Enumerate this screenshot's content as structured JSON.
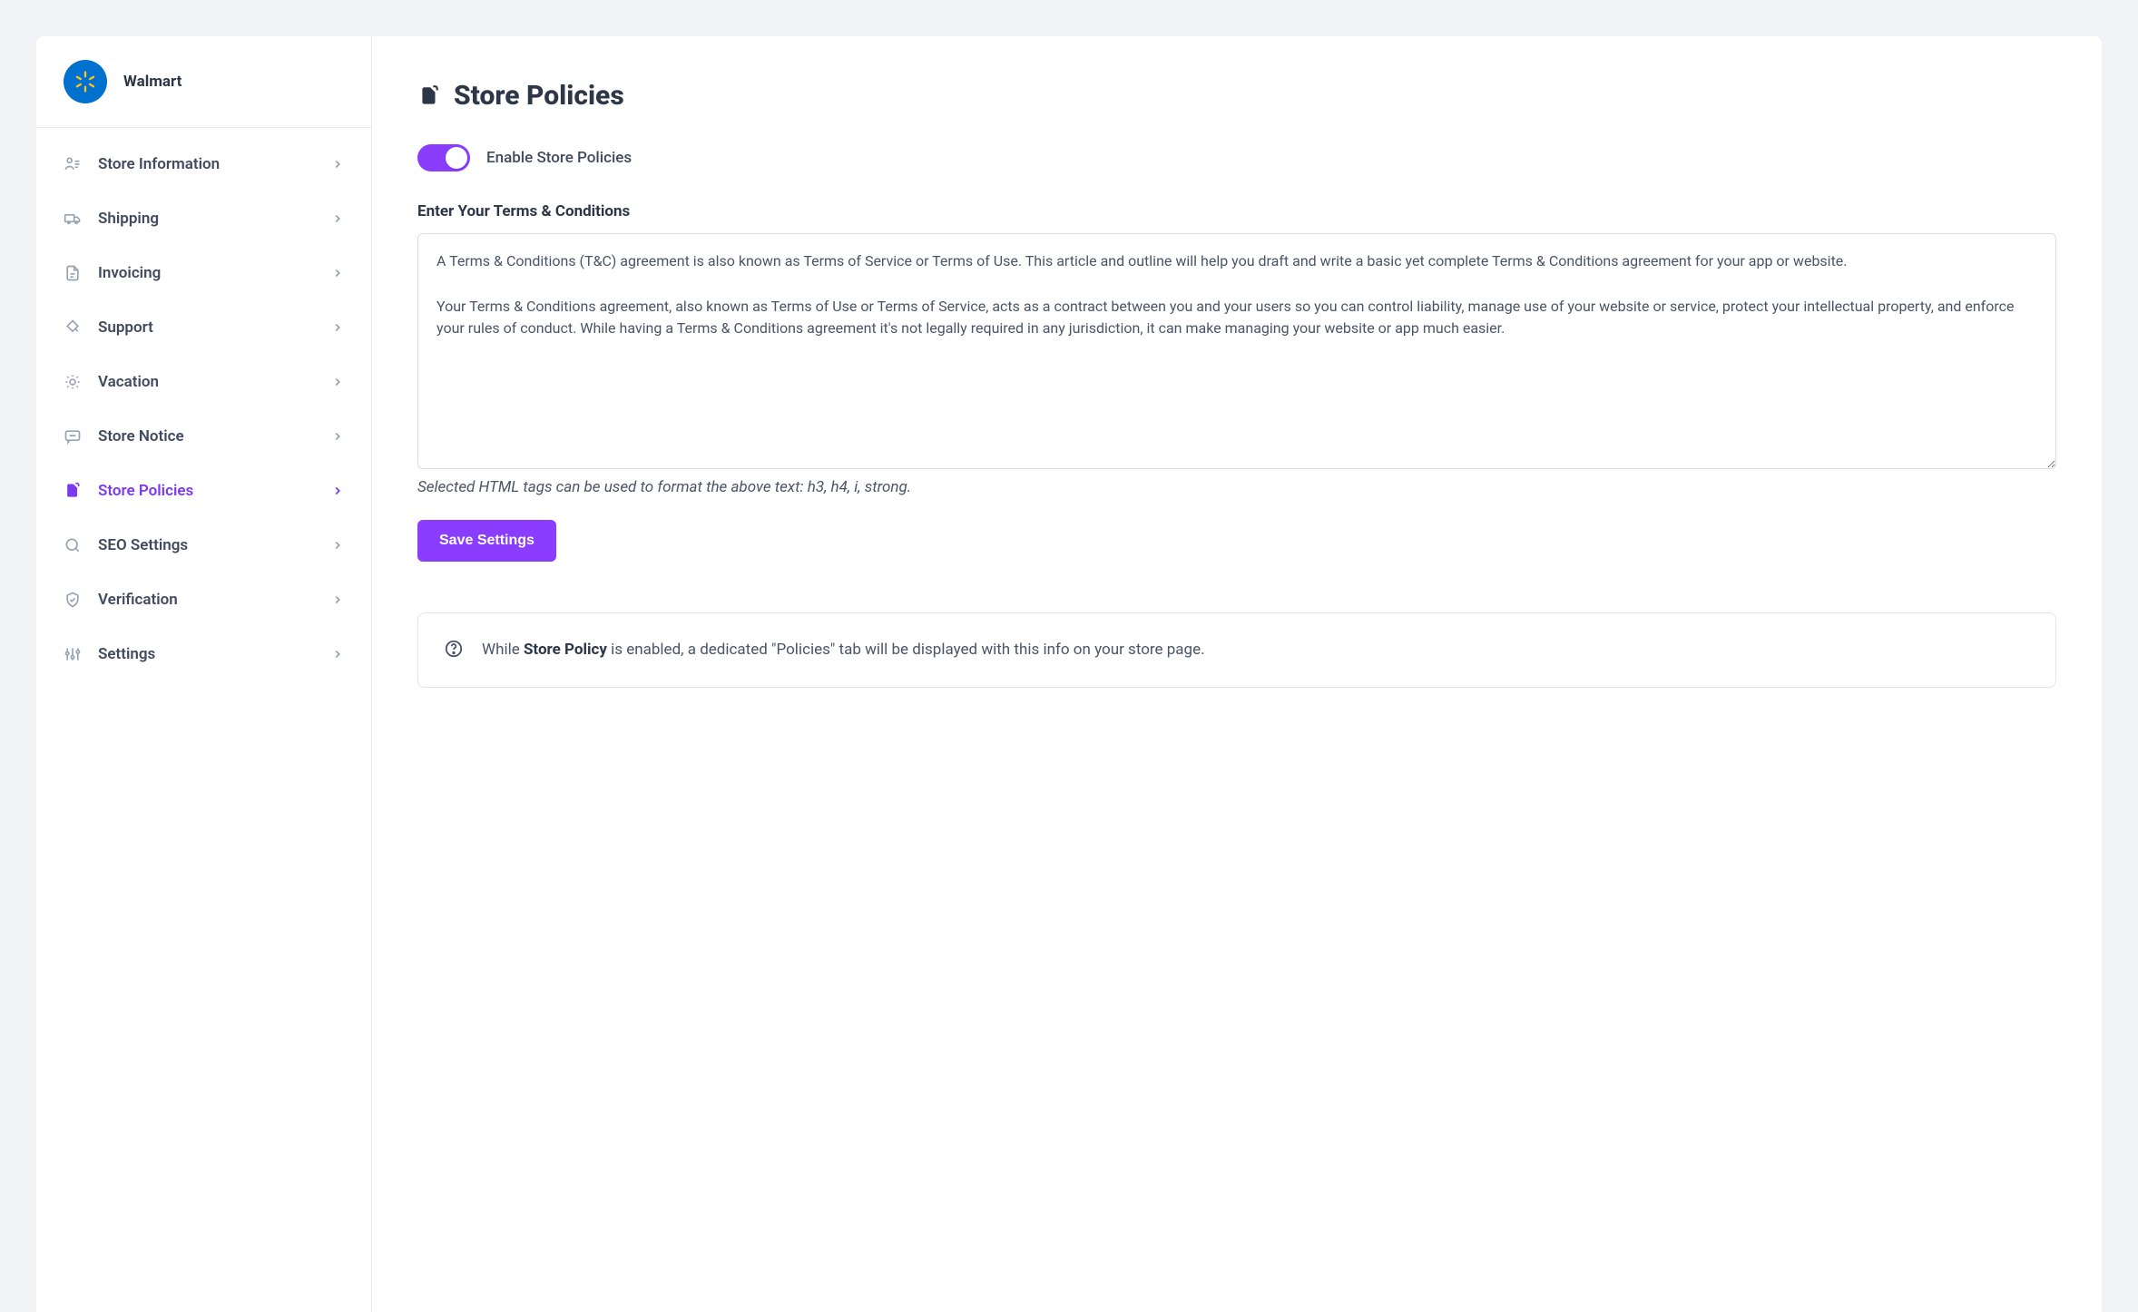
{
  "store": {
    "name": "Walmart"
  },
  "sidebar": {
    "items": [
      {
        "label": "Store Information"
      },
      {
        "label": "Shipping"
      },
      {
        "label": "Invoicing"
      },
      {
        "label": "Support"
      },
      {
        "label": "Vacation"
      },
      {
        "label": "Store Notice"
      },
      {
        "label": "Store Policies"
      },
      {
        "label": "SEO Settings"
      },
      {
        "label": "Verification"
      },
      {
        "label": "Settings"
      }
    ]
  },
  "page": {
    "title": "Store Policies",
    "toggle_label": "Enable Store Policies",
    "textarea_label": "Enter Your Terms & Conditions",
    "textarea_value": "A Terms & Conditions (T&C) agreement is also known as Terms of Service or Terms of Use. This article and outline will help you draft and write a basic yet complete Terms & Conditions agreement for your app or website.\n\nYour Terms & Conditions agreement, also known as Terms of Use or Terms of Service, acts as a contract between you and your users so you can control liability, manage use of your website or service, protect your intellectual property, and enforce your rules of conduct. While having a Terms & Conditions agreement it's not legally required in any jurisdiction, it can make managing your website or app much easier.",
    "hint": "Selected HTML tags can be used to format the above text: h3, h4, i, strong.",
    "save_label": "Save Settings",
    "notice_prefix": "While ",
    "notice_bold": "Store Policy",
    "notice_suffix": " is enabled, a dedicated \"Policies\" tab will be displayed with this info on your store page."
  }
}
